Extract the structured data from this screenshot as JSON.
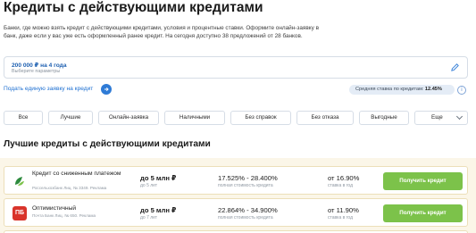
{
  "header": {
    "title": "Кредиты с действующими кредитами",
    "intro": "Банки, где можно взять кредит с действующими кредитами, условия и процентные ставки. Оформите онлайн-заявку в банк, даже если у вас уже есть оформленный ранее кредит. На сегодня доступно 38 предложений от 28 банков."
  },
  "params": {
    "value": "200 000 ₽ на 4 года",
    "hint": "Выберите параметры",
    "edit_icon": "pencil-icon"
  },
  "apply": {
    "label": "Подать единую заявку на кредит",
    "icon": "arrow-right-icon"
  },
  "avg_rate": {
    "label": "Средняя ставка по кредитам:",
    "value": "12.45%",
    "info_icon": "info-icon",
    "info_glyph": "i"
  },
  "tabs": [
    "Все",
    "Лучшие",
    "Онлайн-заявка",
    "Наличными",
    "Без справок",
    "Без отказа",
    "Выгодные",
    "Еще"
  ],
  "section_title": "Лучшие кредиты с действующими кредитами",
  "offers": [
    {
      "name": "Кредит со сниженным платежом",
      "license": "Россельхозбанк Лиц. № 3349. Реклама",
      "amount": "до 5 млн ₽",
      "term": "до 5 лет",
      "rate_range": "17.525% - 28.400%",
      "rate_note": "полная стоимость кредита",
      "rate_from": "от 16.90%",
      "rate_from_note": "ставка в год",
      "button": "Получить кредит",
      "logo_icon": "rosselkhozbank-logo-icon",
      "logo_color": "#2e8b3e"
    },
    {
      "name": "Оптимистичный",
      "license": "Почта Банк Лиц. № 650. Реклама",
      "amount": "до 5 млн ₽",
      "term": "до 7 лет",
      "rate_range": "22.864% - 34.900%",
      "rate_note": "полная стоимость кредита",
      "rate_from": "от 11.90%",
      "rate_from_note": "ставка в год",
      "button": "Получить кредит",
      "logo_icon": "pochta-bank-logo-icon",
      "logo_text": "ПБ",
      "logo_color": "#d9342b"
    }
  ],
  "colors": {
    "accent_green": "#7cc24a",
    "link_blue": "#1d6fd1",
    "offers_background": "#fbf6e8"
  }
}
